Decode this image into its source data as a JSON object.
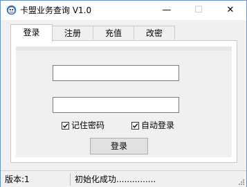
{
  "window": {
    "title": "卡盟业务查询 V1.0",
    "min_glyph": "—",
    "max_glyph": "☐",
    "close_glyph": "✕"
  },
  "tabs": [
    {
      "label": "登录",
      "active": true
    },
    {
      "label": "注册",
      "active": false
    },
    {
      "label": "充值",
      "active": false
    },
    {
      "label": "改密",
      "active": false
    }
  ],
  "login_form": {
    "username_value": "",
    "password_value": "",
    "remember_label": "记住密码",
    "remember_checked": true,
    "autologin_label": "自动登录",
    "autologin_checked": true,
    "login_button": "登录"
  },
  "status_bar": {
    "version": "版本:1",
    "message": "初始化成功..............."
  },
  "colors": {
    "accent_icon": "#2a7fd4",
    "window_border": "#6e8fb8"
  }
}
